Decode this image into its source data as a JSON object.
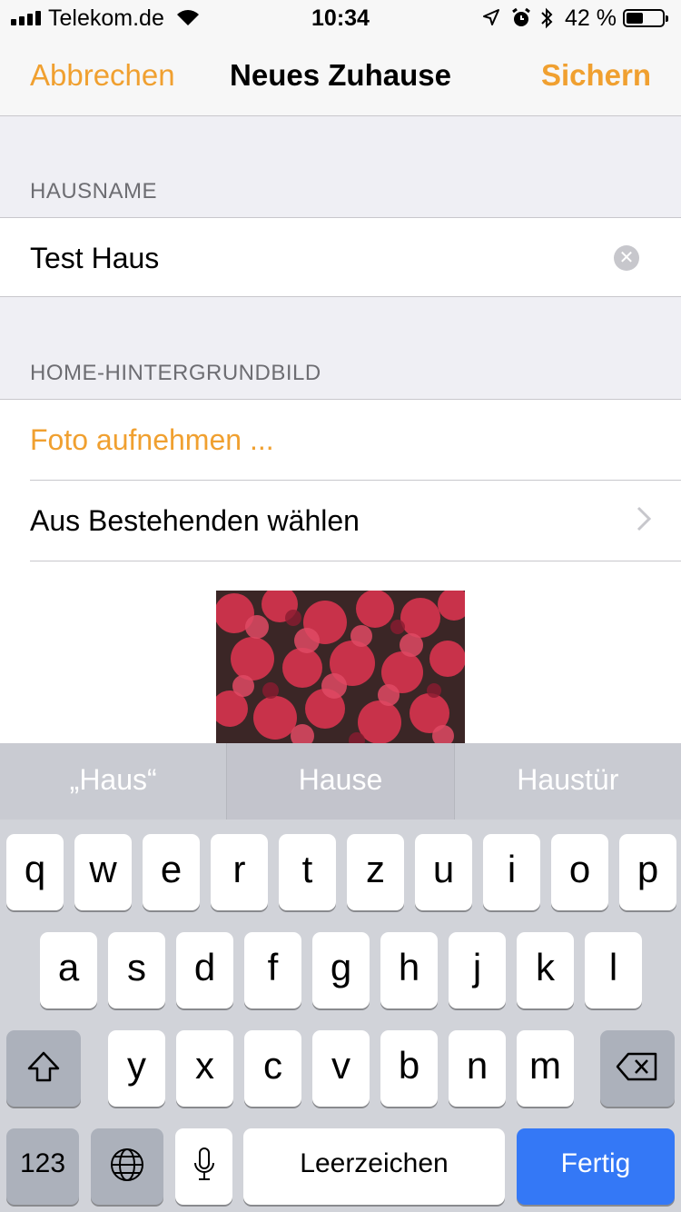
{
  "status_bar": {
    "carrier": "Telekom.de",
    "time": "10:34",
    "battery_percent": "42 %",
    "battery_level": 0.42,
    "icons": [
      "signal-icon",
      "wifi-icon",
      "location-icon",
      "alarm-icon",
      "bluetooth-icon",
      "battery-icon"
    ]
  },
  "nav": {
    "cancel": "Abbrechen",
    "title": "Neues Zuhause",
    "save": "Sichern"
  },
  "accent_color": "#f0a030",
  "home_name": {
    "header": "HAUSNAME",
    "value": "Test Haus"
  },
  "wallpaper": {
    "header": "HOME-HINTERGRUNDBILD",
    "take_photo": "Foto aufnehmen ...",
    "choose_existing": "Aus Bestehenden wählen"
  },
  "keyboard": {
    "suggestions": [
      "„Haus“",
      "Hause",
      "Haustür"
    ],
    "row1": [
      "q",
      "w",
      "e",
      "r",
      "t",
      "z",
      "u",
      "i",
      "o",
      "p"
    ],
    "row2": [
      "a",
      "s",
      "d",
      "f",
      "g",
      "h",
      "j",
      "k",
      "l"
    ],
    "row3": [
      "y",
      "x",
      "c",
      "v",
      "b",
      "n",
      "m"
    ],
    "numbers_key": "123",
    "space_key": "Leerzeichen",
    "done_key": "Fertig"
  }
}
